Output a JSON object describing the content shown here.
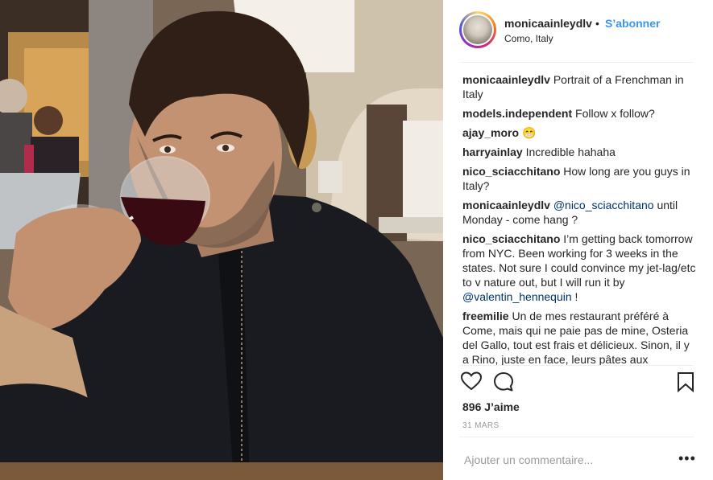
{
  "post": {
    "username": "monicaainleydlv",
    "separator": "•",
    "follow_label": "S’abonner",
    "location": "Como, Italy"
  },
  "comments": [
    {
      "user": "monicaainleydlv",
      "text": "Portrait of a Frenchman in Italy"
    },
    {
      "user": "models.independent",
      "text": "Follow x follow?"
    },
    {
      "user": "ajay_moro",
      "text": "😁"
    },
    {
      "user": "harryainlay",
      "text": "Incredible hahaha"
    },
    {
      "user": "nico_sciacchitano",
      "text": "How long are you guys in Italy?"
    },
    {
      "user": "monicaainleydlv",
      "mention": "@nico_sciacchitano",
      "text": "until Monday - come hang ?"
    },
    {
      "user": "nico_sciacchitano",
      "text": "I’m getting back tomorrow from NYC. Been working for 3 weeks in the states. Not sure I could convince my jet-lag/etc to v nature out, but I will run it by",
      "mention_after": "@valentin_hennequin",
      "tail": "!"
    },
    {
      "user": "freemilie",
      "text": "Un de mes restaurant préféré à Come, mais qui ne paie pas de mine, Osteria del Gallo, tout est frais et délicieux. Sinon, il y a Rino, juste en face, leurs pâtes aux"
    }
  ],
  "likes_label": "896 J’aime",
  "date_label": "31 MARS",
  "add_comment_placeholder": "Ajouter un commentaire...",
  "more_label": "•••",
  "icons": {
    "like": "heart-icon",
    "comment": "comment-icon",
    "save": "bookmark-icon",
    "more": "more-options-icon"
  },
  "colors": {
    "follow": "#3897f0",
    "text": "#262626",
    "muted": "#999999",
    "mention": "#003569"
  }
}
